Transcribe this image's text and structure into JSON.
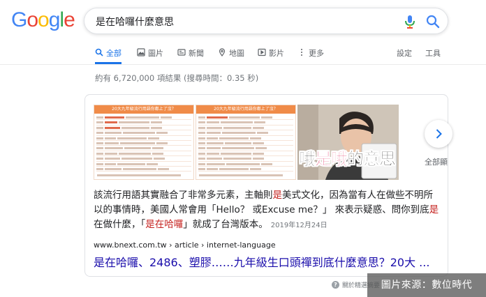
{
  "logo": {
    "letters": [
      "G",
      "o",
      "o",
      "g",
      "l",
      "e"
    ],
    "colors": [
      "#4285F4",
      "#EA4335",
      "#FBBC05",
      "#4285F4",
      "#34A853",
      "#EA4335"
    ]
  },
  "search": {
    "query": "是在哈囉什麼意思",
    "mic_icon": "mic-icon",
    "search_icon": "search-icon"
  },
  "tabs": [
    {
      "label": "全部",
      "icon": "search-icon",
      "active": true
    },
    {
      "label": "圖片",
      "icon": "image-icon"
    },
    {
      "label": "新聞",
      "icon": "news-icon"
    },
    {
      "label": "地圖",
      "icon": "map-pin-icon"
    },
    {
      "label": "影片",
      "icon": "video-icon"
    },
    {
      "label": "更多",
      "icon": "more-vert-icon"
    }
  ],
  "tools": {
    "settings": "設定",
    "tools": "工具"
  },
  "result_stats": "約有 6,720,000 項結果 (搜尋時間：0.35 秒)",
  "featured": {
    "images": [
      {
        "title": "20大九年級流行用語你都上了沒？"
      },
      {
        "title": "20大九年級流行用語你都上了沒？"
      },
      {
        "overlay_text_a": "哦",
        "overlay_text_b": "是哦",
        "overlay_text_c": "的意思"
      }
    ],
    "next_icon": "chevron-right-icon",
    "view_all": "全部顯",
    "snippet": {
      "p1": "該流行用語其實融合了非常多元素，主軸則",
      "e1": "是",
      "p2": "美式文化，因為當有人在做些不明所以的事情時，美國人常會用「Hello？ 或Excuse me？」 來表示疑惑、問你到底",
      "e2": "是",
      "p3": "在做什麼，「",
      "e3": "是在哈囉",
      "p4": "」就成了台灣版本。",
      "date": "2019年12月24日"
    },
    "url": "www.bnext.com.tw › article › internet-language",
    "title": "是在哈囉、2486、塑膠……九年級生口頭禪到底什麼意思？20大 ..."
  },
  "feedback": "關於精選摘要",
  "source_badge": "圖片來源：數位時代",
  "accent": "#1a73e8",
  "link_color": "#1a0dab",
  "emphasis_color": "#c5221f"
}
